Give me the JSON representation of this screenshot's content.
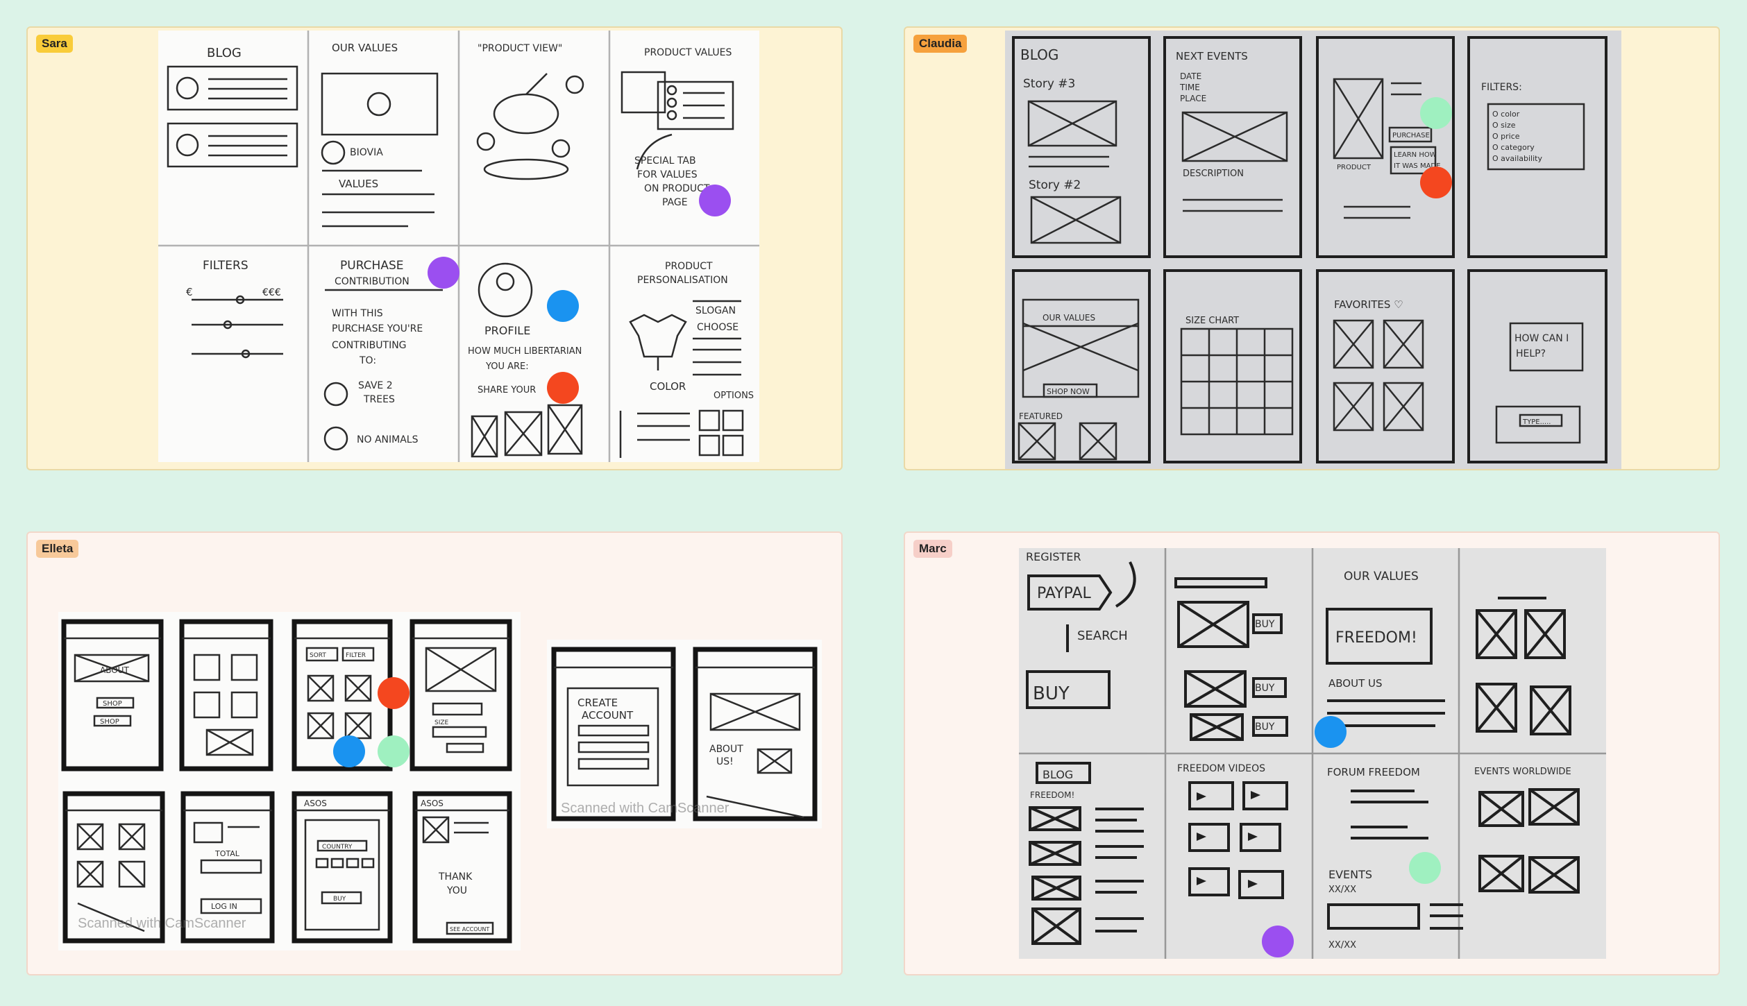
{
  "frames": [
    {
      "id": "sara",
      "label": "Sara"
    },
    {
      "id": "claudia",
      "label": "Claudia"
    },
    {
      "id": "elleta",
      "label": "Elleta"
    },
    {
      "id": "marc",
      "label": "Marc"
    }
  ],
  "sketch_text": {
    "sara": [
      "BLOG",
      "OUR VALUES",
      "\"PRODUCT VIEW\"",
      "PRODUCT VALUES",
      "BIOVIA",
      "VALUES",
      "SPECIAL TAB",
      "FOR VALUES",
      "ON PRODUCT",
      "PAGE",
      "FILTERS",
      "€",
      "€€€",
      "PURCHASE",
      "CONTRIBUTION",
      "WITH THIS",
      "PURCHASE YOU'RE",
      "CONTRIBUTING",
      "TO:",
      "SAVE 2",
      "TREES",
      "NO ANIMALS",
      "PROFILE",
      "HOW MUCH LIBERTARIAN",
      "YOU ARE:",
      "SHARE YOUR",
      "PRODUCT",
      "PERSONALISATION",
      "SLOGAN",
      "CHOOSE",
      "COLOR",
      "OPTIONS"
    ],
    "claudia": [
      "BLOG",
      "Story #3",
      "Story #2",
      "NEXT EVENTS",
      "DATE",
      "TIME",
      "PLACE",
      "DESCRIPTION",
      "PRODUCT",
      "PURCHASE",
      "LEARN HOW",
      "IT WAS MADE",
      "FILTERS:",
      "O color",
      "O size",
      "O price",
      "O category",
      "O availability",
      "OUR VALUES",
      "SHOP NOW",
      "FEATURED",
      "SIZE CHART",
      "FAVORITES ♡",
      "HOW CAN I",
      "HELP?",
      "TYPE....."
    ],
    "elleta": [
      "ABOUT",
      "SHOP",
      "SHOP",
      "SORT",
      "FILTER",
      "SIZE",
      "TOTAL",
      "LOG IN",
      "ASOS",
      "COUNTRY",
      "BUY",
      "ASOS",
      "THANK",
      "YOU",
      "SEE ACCOUNT",
      "CREATE",
      "ACCOUNT",
      "ABOUT",
      "US!"
    ],
    "marc": [
      "REGISTER",
      "PAYPAL",
      "SEARCH",
      "BUY",
      "BUY",
      "BUY",
      "BUY",
      "OUR VALUES",
      "FREEDOM!",
      "ABOUT US",
      "BLOG",
      "FREEDOM!",
      "FREEDOM VIDEOS",
      "FORUM FREEDOM",
      "EVENTS",
      "XX/XX",
      "XX/XX",
      "EVENTS WORLDWIDE"
    ]
  },
  "watermarks": {
    "camscanner": "Scanned with CamScanner"
  },
  "colors": {
    "background": "#dcf3e8",
    "frame_yellow": "#fdf3d4",
    "frame_pink": "#fdf4ef",
    "tag_yellow": "#f9cc3a",
    "tag_orange": "#f6a13d",
    "tag_peach": "#f7c99a",
    "tag_pink": "#f6cfc8",
    "vote_purple": "#9b4ff0",
    "vote_blue": "#1a93f0",
    "vote_red": "#f4471f",
    "vote_green": "#9ff0c0"
  }
}
